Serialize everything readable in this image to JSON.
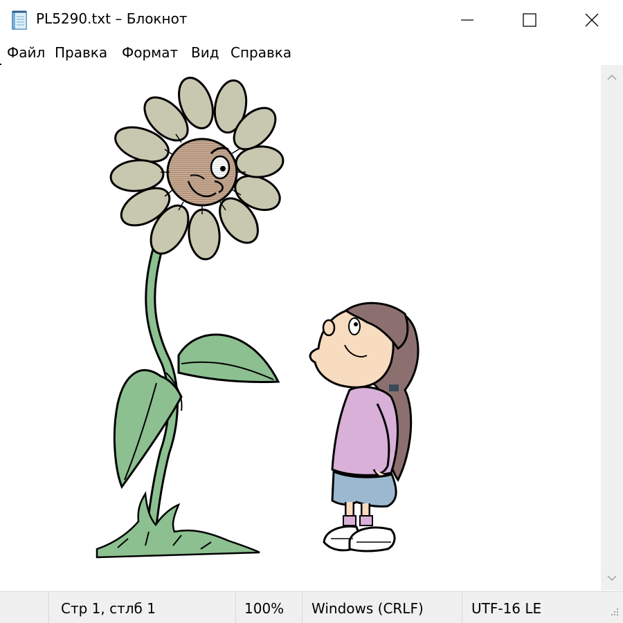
{
  "window": {
    "title": "PL5290.txt – Блокнот",
    "icon": "notepad-icon",
    "controls": [
      "minimize-icon",
      "maximize-icon",
      "close-icon"
    ]
  },
  "menu": {
    "file": "Файл",
    "edit": "Правка",
    "format": "Формат",
    "view": "Вид",
    "help": "Справка"
  },
  "editor": {
    "content_description_icon": "ascii-art-flower-and-girl",
    "scrollbar_icons": [
      "chevron-up-icon",
      "chevron-down-icon"
    ]
  },
  "status": {
    "position": "Стр 1, стлб 1",
    "zoom": "100%",
    "line_ending": "Windows (CRLF)",
    "encoding": "UTF-16 LE"
  },
  "colors": {
    "petals": "#c8c8b0",
    "face": "#c8a890",
    "leaves": "#8cc090",
    "hair": "#8c7070",
    "shirt": "#d8b0d8",
    "shorts": "#9cb8d0",
    "skin": "#f8dcc0"
  }
}
